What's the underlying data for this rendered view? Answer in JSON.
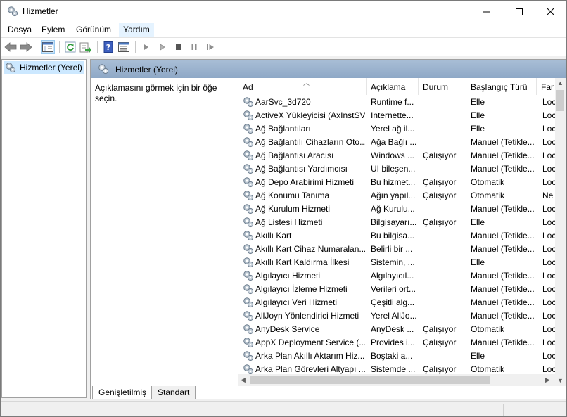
{
  "window": {
    "title": "Hizmetler"
  },
  "menu": [
    "Dosya",
    "Eylem",
    "Görünüm",
    "Yardım"
  ],
  "tree": {
    "item": "Hizmetler (Yerel)"
  },
  "pane": {
    "title": "Hizmetler (Yerel)",
    "description": "Açıklamasını görmek için bir öğe seçin."
  },
  "columns": [
    "Ad",
    "Açıklama",
    "Durum",
    "Başlangıç Türü",
    "Far"
  ],
  "services": [
    {
      "name": "AarSvc_3d720",
      "desc": "Runtime f...",
      "status": "",
      "startup": "Elle",
      "logon": "Loc"
    },
    {
      "name": "ActiveX Yükleyicisi (AxInstSV)",
      "desc": "Internette...",
      "status": "",
      "startup": "Elle",
      "logon": "Loc"
    },
    {
      "name": "Ağ Bağlantıları",
      "desc": "Yerel ağ il...",
      "status": "",
      "startup": "Elle",
      "logon": "Loc"
    },
    {
      "name": "Ağ Bağlantılı Cihazların Oto...",
      "desc": "Ağa Bağlı ...",
      "status": "",
      "startup": "Manuel (Tetikle...",
      "logon": "Loc"
    },
    {
      "name": "Ağ Bağlantısı Aracısı",
      "desc": "Windows ...",
      "status": "Çalışıyor",
      "startup": "Manuel (Tetikle...",
      "logon": "Loc"
    },
    {
      "name": "Ağ Bağlantısı Yardımcısı",
      "desc": "UI bileşen...",
      "status": "",
      "startup": "Manuel (Tetikle...",
      "logon": "Loc"
    },
    {
      "name": "Ağ Depo Arabirimi Hizmeti",
      "desc": "Bu hizmet...",
      "status": "Çalışıyor",
      "startup": "Otomatik",
      "logon": "Loc"
    },
    {
      "name": "Ağ Konumu Tanıma",
      "desc": "Ağın yapıl...",
      "status": "Çalışıyor",
      "startup": "Otomatik",
      "logon": "Ne"
    },
    {
      "name": "Ağ Kurulum Hizmeti",
      "desc": "Ağ Kurulu...",
      "status": "",
      "startup": "Manuel (Tetikle...",
      "logon": "Loc"
    },
    {
      "name": "Ağ Listesi Hizmeti",
      "desc": "Bilgisayarı...",
      "status": "Çalışıyor",
      "startup": "Elle",
      "logon": "Loc"
    },
    {
      "name": "Akıllı Kart",
      "desc": "Bu bilgisa...",
      "status": "",
      "startup": "Manuel (Tetikle...",
      "logon": "Loc"
    },
    {
      "name": "Akıllı Kart Cihaz Numaralan...",
      "desc": "Belirli bir ...",
      "status": "",
      "startup": "Manuel (Tetikle...",
      "logon": "Loc"
    },
    {
      "name": "Akıllı Kart Kaldırma İlkesi",
      "desc": "Sistemin, ...",
      "status": "",
      "startup": "Elle",
      "logon": "Loc"
    },
    {
      "name": "Algılayıcı Hizmeti",
      "desc": "Algılayıcıl...",
      "status": "",
      "startup": "Manuel (Tetikle...",
      "logon": "Loc"
    },
    {
      "name": "Algılayıcı İzleme Hizmeti",
      "desc": "Verileri ort...",
      "status": "",
      "startup": "Manuel (Tetikle...",
      "logon": "Loc"
    },
    {
      "name": "Algılayıcı Veri Hizmeti",
      "desc": "Çeşitli alg...",
      "status": "",
      "startup": "Manuel (Tetikle...",
      "logon": "Loc"
    },
    {
      "name": "AllJoyn Yönlendirici Hizmeti",
      "desc": "Yerel AllJo...",
      "status": "",
      "startup": "Manuel (Tetikle...",
      "logon": "Loc"
    },
    {
      "name": "AnyDesk Service",
      "desc": "AnyDesk ...",
      "status": "Çalışıyor",
      "startup": "Otomatik",
      "logon": "Loc"
    },
    {
      "name": "AppX Deployment Service (...",
      "desc": "Provides i...",
      "status": "Çalışıyor",
      "startup": "Manuel (Tetikle...",
      "logon": "Loc"
    },
    {
      "name": "Arka Plan Akıllı Aktarım Hiz...",
      "desc": "Boştaki a...",
      "status": "",
      "startup": "Elle",
      "logon": "Loc"
    },
    {
      "name": "Arka Plan Görevleri Altyapı ...",
      "desc": "Sistemde ...",
      "status": "Çalışıyor",
      "startup": "Otomatik",
      "logon": "Loc"
    }
  ],
  "tabs": [
    "Genişletilmiş",
    "Standart"
  ]
}
